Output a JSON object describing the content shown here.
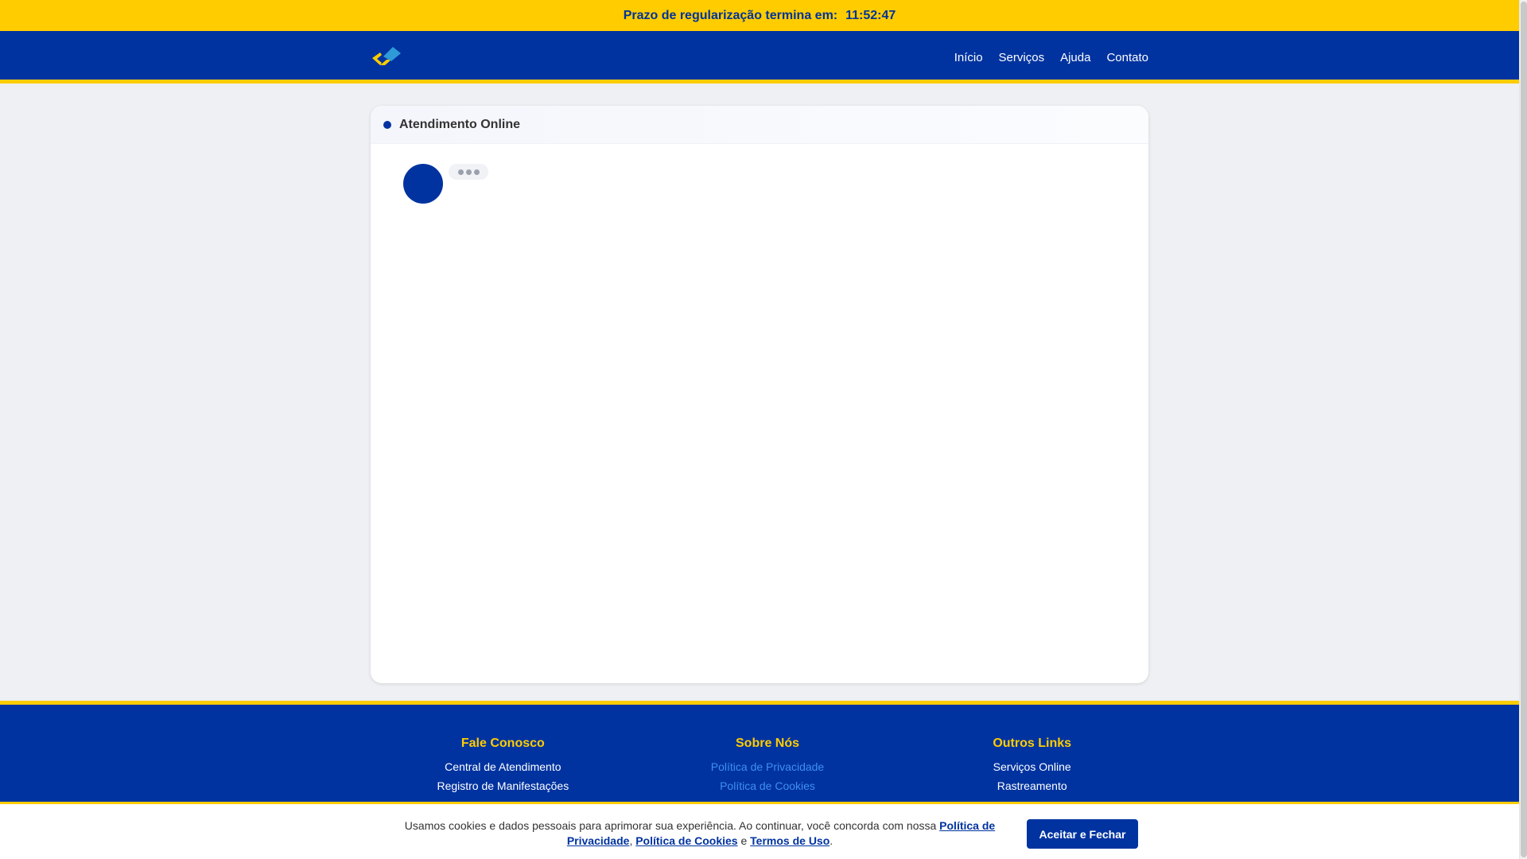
{
  "countdown": {
    "label": "Prazo de regularização termina em:",
    "time": "11:52:47"
  },
  "header": {
    "nav": [
      "Início",
      "Serviços",
      "Ajuda",
      "Contato"
    ]
  },
  "chat": {
    "title": "Atendimento Online"
  },
  "footer": {
    "columns": [
      {
        "title": "Fale Conosco",
        "links": [
          "Central de Atendimento",
          "Registro de Manifestações"
        ]
      },
      {
        "title": "Sobre Nós",
        "links": [
          "Política de Privacidade",
          "Política de Cookies"
        ]
      },
      {
        "title": "Outros Links",
        "links": [
          "Serviços Online",
          "Rastreamento"
        ]
      }
    ]
  },
  "cookie": {
    "text": "Usamos cookies e dados pessoais para aprimorar sua experiência. Ao continuar, você concorda com nossa",
    "privacy": "Política de Privacidade",
    "sep": ",",
    "cookies": "Política de Cookies",
    "and": "e",
    "terms": "Termos de Uso",
    "end": ".",
    "button": "Aceitar e Fechar"
  },
  "colors": {
    "brand_blue": "#0033a0",
    "brand_yellow": "#ffcc00"
  }
}
